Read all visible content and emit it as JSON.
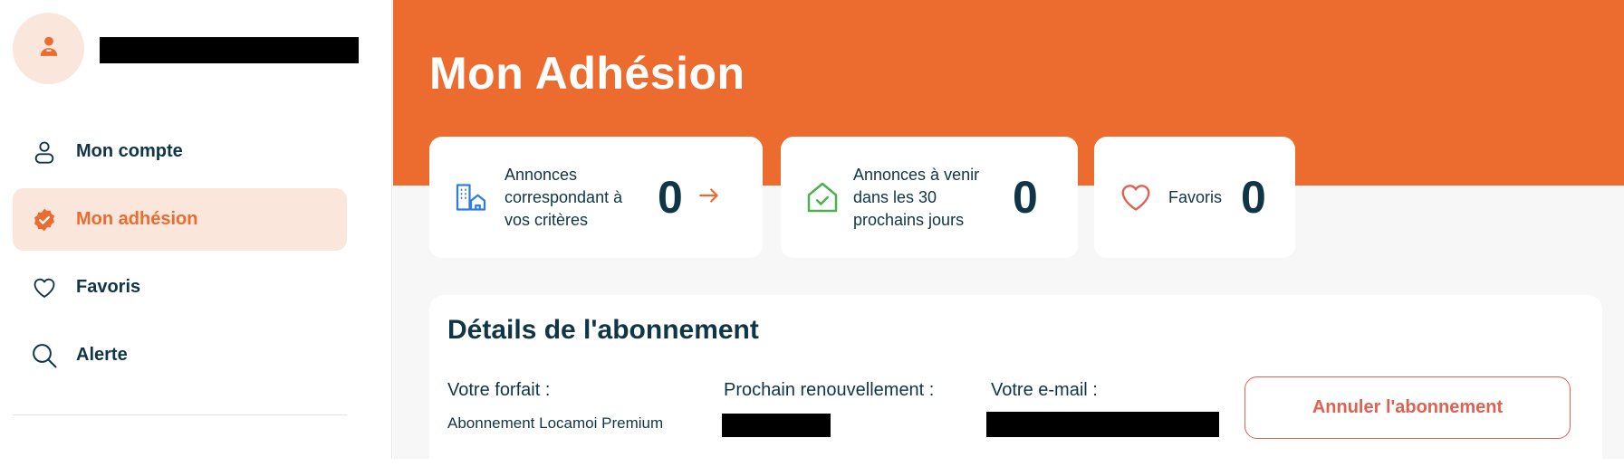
{
  "sidebar": {
    "avatar_icon": "user-icon",
    "items": [
      {
        "label": "Mon compte",
        "icon": "user-outline-icon",
        "active": false
      },
      {
        "label": "Mon adhésion",
        "icon": "verified-badge-icon",
        "active": true
      },
      {
        "label": "Favoris",
        "icon": "heart-icon",
        "active": false
      },
      {
        "label": "Alerte",
        "icon": "search-icon",
        "active": false
      }
    ]
  },
  "header": {
    "title": "Mon Adhésion"
  },
  "stats": [
    {
      "label_lines": [
        "Annonces",
        "correspondant à",
        "vos critères"
      ],
      "count": "0",
      "icon": "building-home-icon",
      "has_arrow": true
    },
    {
      "label_lines": [
        "Annonces à venir",
        "dans les 30",
        "prochains jours"
      ],
      "count": "0",
      "icon": "house-check-icon",
      "has_arrow": false
    },
    {
      "label_lines": [
        "Favoris"
      ],
      "count": "0",
      "icon": "heart-icon",
      "has_arrow": false
    }
  ],
  "details": {
    "title": "Détails de l'abonnement",
    "plan_label": "Votre forfait :",
    "plan_value": "Abonnement Locamoi Premium",
    "renewal_label": "Prochain renouvellement :",
    "email_label": "Votre e-mail :",
    "cancel_label": "Annuler l'abonnement"
  },
  "colors": {
    "accent": "#ec6b2f",
    "accent_light": "#fbe6dc",
    "text": "#0f3547",
    "danger": "#e2604f",
    "blue_icon": "#2f7de1",
    "green_icon": "#4caf50"
  }
}
